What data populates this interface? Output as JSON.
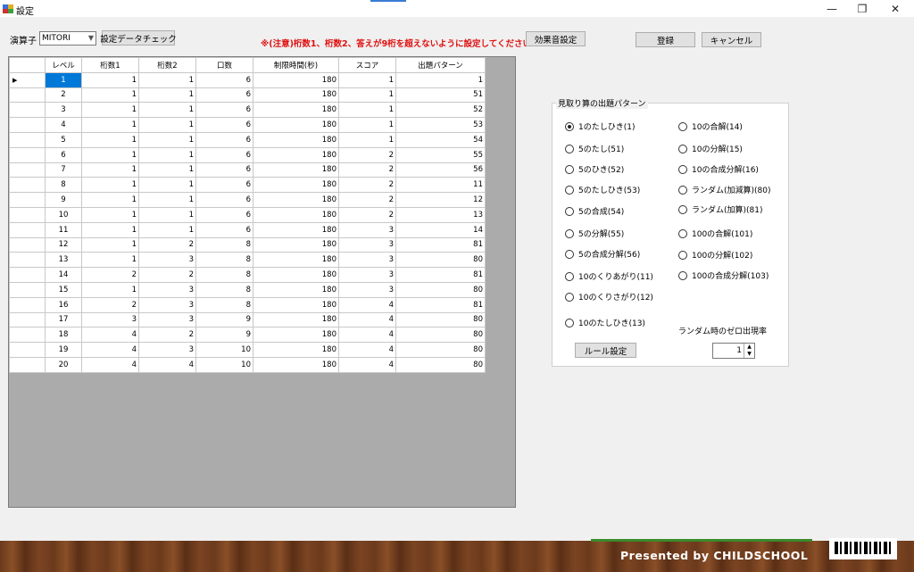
{
  "window": {
    "title": "設定",
    "minimize": "—",
    "restore": "❐",
    "close": "✕"
  },
  "toolbar": {
    "operator_label": "演算子",
    "operator_value": "MITORI",
    "check_button": "設定データチェック",
    "warning": "※(注意)桁数1、桁数2、答えが9桁を超えないように設定してください",
    "sound_button": "効果音設定",
    "register_button": "登録",
    "cancel_button": "キャンセル"
  },
  "grid": {
    "headers": [
      "レベル",
      "桁数1",
      "桁数2",
      "口数",
      "制限時間(秒)",
      "スコア",
      "出題パターン"
    ],
    "rows": [
      [
        "1",
        "1",
        "1",
        "6",
        "180",
        "1",
        "1"
      ],
      [
        "2",
        "1",
        "1",
        "6",
        "180",
        "1",
        "51"
      ],
      [
        "3",
        "1",
        "1",
        "6",
        "180",
        "1",
        "52"
      ],
      [
        "4",
        "1",
        "1",
        "6",
        "180",
        "1",
        "53"
      ],
      [
        "5",
        "1",
        "1",
        "6",
        "180",
        "1",
        "54"
      ],
      [
        "6",
        "1",
        "1",
        "6",
        "180",
        "2",
        "55"
      ],
      [
        "7",
        "1",
        "1",
        "6",
        "180",
        "2",
        "56"
      ],
      [
        "8",
        "1",
        "1",
        "6",
        "180",
        "2",
        "11"
      ],
      [
        "9",
        "1",
        "1",
        "6",
        "180",
        "2",
        "12"
      ],
      [
        "10",
        "1",
        "1",
        "6",
        "180",
        "2",
        "13"
      ],
      [
        "11",
        "1",
        "1",
        "6",
        "180",
        "3",
        "14"
      ],
      [
        "12",
        "1",
        "2",
        "8",
        "180",
        "3",
        "81"
      ],
      [
        "13",
        "1",
        "3",
        "8",
        "180",
        "3",
        "80"
      ],
      [
        "14",
        "2",
        "2",
        "8",
        "180",
        "3",
        "81"
      ],
      [
        "15",
        "1",
        "3",
        "8",
        "180",
        "3",
        "80"
      ],
      [
        "16",
        "2",
        "3",
        "8",
        "180",
        "4",
        "81"
      ],
      [
        "17",
        "3",
        "3",
        "9",
        "180",
        "4",
        "80"
      ],
      [
        "18",
        "4",
        "2",
        "9",
        "180",
        "4",
        "80"
      ],
      [
        "19",
        "4",
        "3",
        "10",
        "180",
        "4",
        "80"
      ],
      [
        "20",
        "4",
        "4",
        "10",
        "180",
        "4",
        "80"
      ]
    ],
    "current_row_marker": "▶"
  },
  "pattern_group": {
    "title": "見取り算の出題パターン",
    "left_options": [
      "1のたしひき(1)",
      "5のたし(51)",
      "5のひき(52)",
      "5のたしひき(53)",
      "5の合成(54)",
      "5の分解(55)",
      "5の合成分解(56)",
      "10のくりあがり(11)",
      "10のくりさがり(12)",
      "10のたしひき(13)"
    ],
    "right_options": [
      "10の合解(14)",
      "10の分解(15)",
      "10の合成分解(16)",
      "ランダム(加減算)(80)",
      "ランダム(加算)(81)",
      "100の合解(101)",
      "100の分解(102)",
      "100の合成分解(103)"
    ],
    "selected": "1のたしひき(1)",
    "rule_button": "ルール設定",
    "zero_rate_label": "ランダム時のゼロ出現率",
    "zero_rate_value": "1"
  },
  "footer": {
    "text": "Presented by CHILDSCHOOL"
  }
}
